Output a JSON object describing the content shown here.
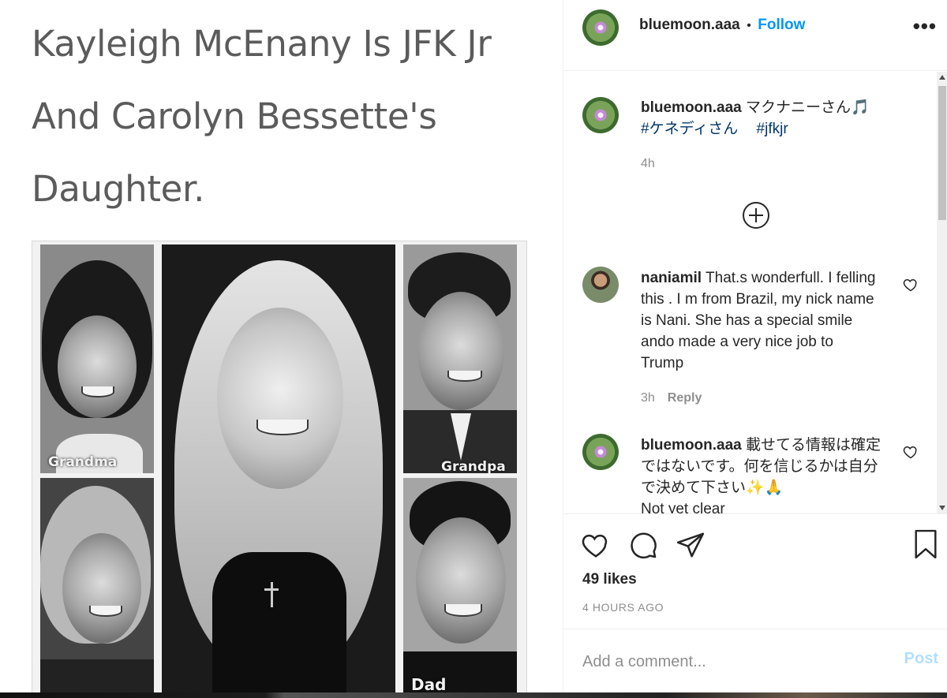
{
  "media": {
    "headline": "Kayleigh McEnany Is JFK Jr And Carolyn Bessette's Daughter.",
    "captions": {
      "grandma": "Grandma",
      "grandpa": "Grandpa",
      "dad": "Dad"
    }
  },
  "post": {
    "username": "bluemoon.aaa",
    "separator": "•",
    "follow_label": "Follow",
    "more_icon": "more-horizontal-icon"
  },
  "comments": [
    {
      "username": "bluemoon.aaa",
      "text": "マクナニーさん🎵",
      "tags": [
        "#ケネディさん",
        "#jfkjr"
      ],
      "time": "4h"
    },
    {
      "username": "naniamil",
      "text": "That.s wonderfull. I felling this . I m from Brazil, my nick name is Nani. She has a special smile ando made a very nice job to Trump",
      "time": "3h",
      "reply_label": "Reply"
    },
    {
      "username": "bluemoon.aaa",
      "text": "載せてる情報は確定ではないです。何を信じるかは自分で決めて下さい✨🙏",
      "text2": "Not yet clear"
    }
  ],
  "actions": {
    "likes": "49 likes",
    "time_ago": "4 HOURS AGO"
  },
  "composer": {
    "placeholder": "Add a comment...",
    "post_label": "Post"
  },
  "colors": {
    "accent": "#0095f6",
    "hashtag": "#00376b",
    "muted": "#8e8e8e",
    "post_disabled": "#b2dffc"
  }
}
